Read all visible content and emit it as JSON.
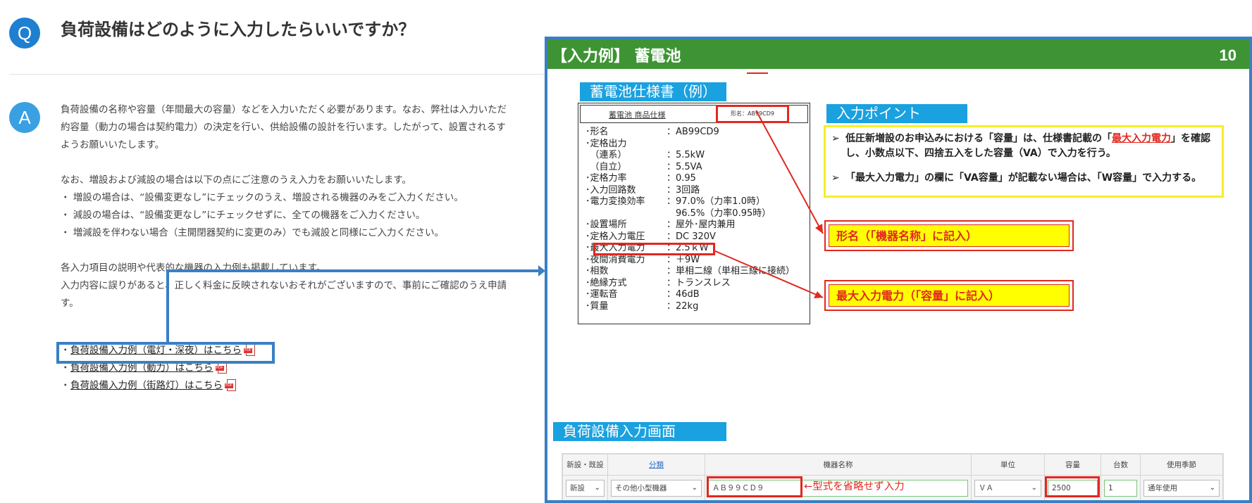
{
  "faq": {
    "q_badge": "Q",
    "a_badge": "A",
    "question": "負荷設備はどのように入力したらいいですか？",
    "answer_lines": [
      "負荷設備の名称や容量（年間最大の容量）などを入力いただく必要があります。なお、弊社は入力いただ",
      "約容量（動力の場合は契約電力）の決定を行い、供給設備の設計を行います。したがって、設置されるす",
      "ようお願いいたします。",
      "",
      "なお、増設および減設の場合は以下の点にご注意のうえ入力をお願いいたします。",
      "・ 増設の場合は、“設備変更なし”にチェックのうえ、増設される機器のみをご入力ください。",
      "・ 減設の場合は、“設備変更なし”にチェックせずに、全ての機器をご入力ください。",
      "・ 増減設を伴わない場合（主開閉器契約に変更のみ）でも減設と同様にご入力ください。",
      "",
      "各入力項目の説明や代表的な機器の入力例も掲載しています。",
      "入力内容に誤りがあると、正しく料金に反映されないおそれがございますので、事前にご確認のうえ申請",
      "す。"
    ],
    "links": [
      "負荷設備入力例（電灯・深夜）はこちら",
      "負荷設備入力例（動力）はこちら",
      "負荷設備入力例（街路灯）はこちら"
    ],
    "bullet": "・",
    "pdf_tag": "PDF"
  },
  "slide": {
    "title": "【入力例】 蓄電池",
    "page_number": "10",
    "spec_label": "蓄電池仕様書（例）",
    "spec_header_name": "蓄電池 商品仕様",
    "spec_header_model": "形名：AB99CD9",
    "spec_rows": [
      {
        "k": "･形名",
        "v": "：AB99CD9"
      },
      {
        "k": "･定格出力",
        "v": ""
      },
      {
        "k": "　（連系）",
        "v": "：5.5kW"
      },
      {
        "k": "　（自立）",
        "v": "：5.5VA"
      },
      {
        "k": "･定格力率",
        "v": "：0.95"
      },
      {
        "k": "･入力回路数",
        "v": "：3回路"
      },
      {
        "k": "･電力変換効率",
        "v": "：97.0%（力率1.0時）"
      },
      {
        "k": "",
        "v": "　96.5%（力率0.95時）"
      },
      {
        "k": "･設置場所",
        "v": "：屋外･屋内兼用"
      },
      {
        "k": "･定格入力電圧",
        "v": "：DC 320V"
      },
      {
        "k": "･最大入力電力",
        "v": "：2.5ｋW"
      },
      {
        "k": "･夜間消費電力",
        "v": "：＋9W"
      },
      {
        "k": "･相数",
        "v": "：単相二線（単相三線に接続）"
      },
      {
        "k": "･絶縁方式",
        "v": "：トランスレス"
      },
      {
        "k": "･運転音",
        "v": "：46dB"
      },
      {
        "k": "･質量",
        "v": "：22kg"
      }
    ],
    "points_label": "入力ポイント",
    "points": {
      "marker": "➢",
      "p1_a": "低圧新増設のお申込みにおける「容量」は、仕様書記載の「",
      "p1_red": "最大入力電力",
      "p1_b": "」を確認し、小数点以下、四捨五入をした容量（VA）で入力を行う。",
      "p2": "「最大入力電力」の欄に「VA容量」が記載ない場合は、「W容量」で入力する。"
    },
    "callout_model": "形名（「機器名称」に記入）",
    "callout_capacity": "最大入力電力（「容量」に記入）",
    "form_label": "負荷設備入力画面",
    "form": {
      "headers": [
        "新設・既設",
        "分類",
        "機器名称",
        "単位",
        "容量",
        "台数",
        "使用季節"
      ],
      "row": {
        "new_existing": "新設",
        "category": "その他小型機器",
        "device_name": "ＡＢ９９ＣＤ９",
        "unit": "ＶＡ",
        "capacity": "2500",
        "count": "1",
        "season": "通年使用"
      },
      "note": "←型式を省略せず入力"
    },
    "colors": {
      "header_green": "#3e9434",
      "label_blue": "#1aa1e0",
      "alert_red": "#e0281f",
      "frame_blue": "#3a7fc4"
    }
  }
}
